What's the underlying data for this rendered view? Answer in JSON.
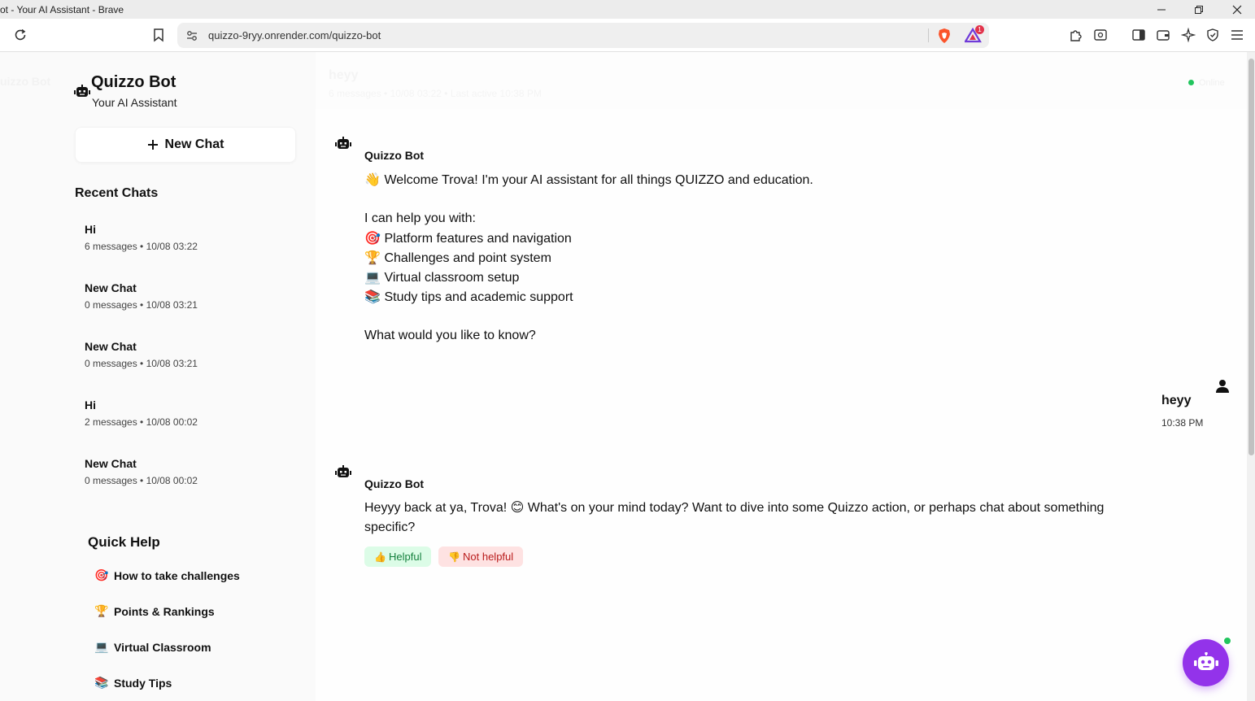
{
  "browser": {
    "window_title": "ot - Your AI Assistant - Brave",
    "url": "quizzo-9ryy.onrender.com/quizzo-bot",
    "notification_count": "1"
  },
  "sidebar": {
    "ghost_brand": "uizzo Bot",
    "brand_name": "Quizzo Bot",
    "brand_subtitle": "Your AI Assistant",
    "new_chat_label": "New Chat",
    "recent_title": "Recent Chats",
    "recent_chats": [
      {
        "title": "Hi",
        "meta": "6 messages • 10/08 03:22"
      },
      {
        "title": "New Chat",
        "meta": "0 messages • 10/08 03:21"
      },
      {
        "title": "New Chat",
        "meta": "0 messages • 10/08 03:21"
      },
      {
        "title": "Hi",
        "meta": "2 messages • 10/08 00:02"
      },
      {
        "title": "New Chat",
        "meta": "0 messages • 10/08 00:02"
      }
    ],
    "quick_help_title": "Quick Help",
    "quick_help": [
      {
        "emoji": "🎯",
        "label": "How to take challenges"
      },
      {
        "emoji": "🏆",
        "label": "Points & Rankings"
      },
      {
        "emoji": "💻",
        "label": "Virtual Classroom"
      },
      {
        "emoji": "📚",
        "label": "Study Tips"
      }
    ]
  },
  "chat": {
    "ghost_header_title": "heyy",
    "ghost_header_sub": "6 messages • 10/08 03:22 • Last active 10:38 PM",
    "ghost_status": "Online",
    "messages": [
      {
        "sender": "Quizzo Bot",
        "lines": [
          {
            "emoji": "👋",
            "text": "Welcome Trova! I'm your AI assistant for all things QUIZZO and education."
          },
          {
            "emoji": "",
            "text": ""
          },
          {
            "emoji": "",
            "text": "I can help you with:"
          },
          {
            "emoji": "🎯",
            "text": "Platform features and navigation"
          },
          {
            "emoji": "🏆",
            "text": "Challenges and point system"
          },
          {
            "emoji": "💻",
            "text": "Virtual classroom setup"
          },
          {
            "emoji": "📚",
            "text": "Study tips and academic support"
          },
          {
            "emoji": "",
            "text": ""
          },
          {
            "emoji": "",
            "text": "What would you like to know?"
          }
        ]
      },
      {
        "sender": "user",
        "text": "heyy",
        "time": "10:38 PM"
      },
      {
        "sender": "Quizzo Bot",
        "line1": "Heyyy back at ya, Trova! 😊 What's on your mind today? Want to dive into some Quizzo action, or perhaps chat about something",
        "line2": "specific?",
        "helpful_label": "Helpful",
        "not_helpful_label": "Not helpful"
      }
    ]
  },
  "colors": {
    "accent_purple": "#9333ea",
    "online_green": "#22c55e",
    "helpful_bg": "#dcfce7",
    "not_helpful_bg": "#fee2e2"
  }
}
